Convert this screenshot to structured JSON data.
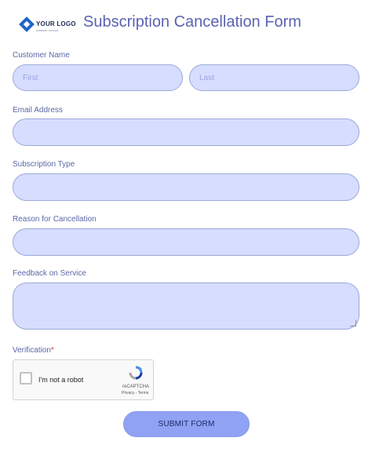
{
  "header": {
    "logo_text": "YOUR LOGO",
    "logo_tagline": "COMPANY SLOGAN",
    "title": "Subscription Cancellation Form"
  },
  "form": {
    "customer_name": {
      "label": "Customer Name",
      "first": {
        "placeholder": "First",
        "value": ""
      },
      "last": {
        "placeholder": "Last",
        "value": ""
      }
    },
    "email": {
      "label": "Email Address",
      "value": ""
    },
    "subscription_type": {
      "label": "Subscription Type",
      "value": ""
    },
    "reason": {
      "label": "Reason for Cancellation",
      "value": ""
    },
    "feedback": {
      "label": "Feedback on Service",
      "value": ""
    },
    "verification": {
      "label": "Verification",
      "required_mark": "*",
      "recaptcha": {
        "checkbox_label": "I'm not a robot",
        "brand": "reCAPTCHA",
        "terms": "Privacy - Terms"
      }
    },
    "submit_label": "SUBMIT FORM"
  },
  "colors": {
    "field_bg": "#d6ddff",
    "title": "#5a63b2",
    "label": "#5b67a6",
    "button": "#8fa2f4"
  }
}
